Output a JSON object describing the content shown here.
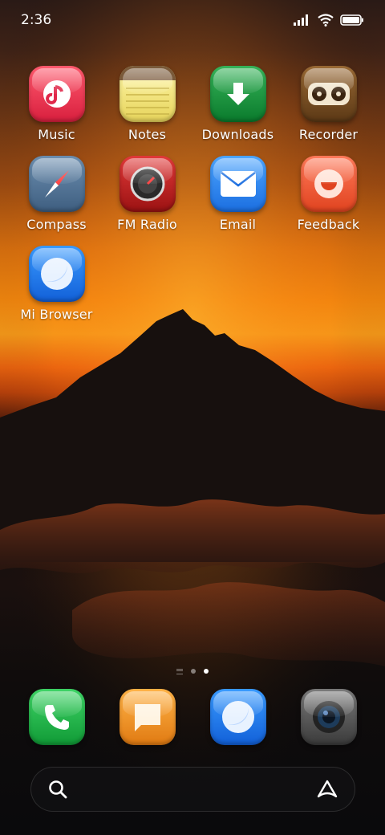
{
  "status_bar": {
    "time": "2:36"
  },
  "apps": [
    {
      "label": "Music",
      "icon": "music-note-icon"
    },
    {
      "label": "Notes",
      "icon": "notes-icon"
    },
    {
      "label": "Downloads",
      "icon": "download-arrow-icon"
    },
    {
      "label": "Recorder",
      "icon": "recorder-icon"
    },
    {
      "label": "Compass",
      "icon": "compass-icon"
    },
    {
      "label": "FM Radio",
      "icon": "radio-dial-icon"
    },
    {
      "label": "Email",
      "icon": "envelope-icon"
    },
    {
      "label": "Feedback",
      "icon": "smile-icon"
    },
    {
      "label": "Mi Browser",
      "icon": "browser-icon"
    }
  ],
  "page_indicator": {
    "pages": 2,
    "current": 2
  },
  "dock": [
    {
      "name": "phone",
      "icon": "phone-icon"
    },
    {
      "name": "messages",
      "icon": "message-icon"
    },
    {
      "name": "browser",
      "icon": "browser-icon"
    },
    {
      "name": "camera",
      "icon": "camera-icon"
    }
  ],
  "search": {
    "left_icon": "search-icon",
    "right_icon": "assistant-icon"
  }
}
